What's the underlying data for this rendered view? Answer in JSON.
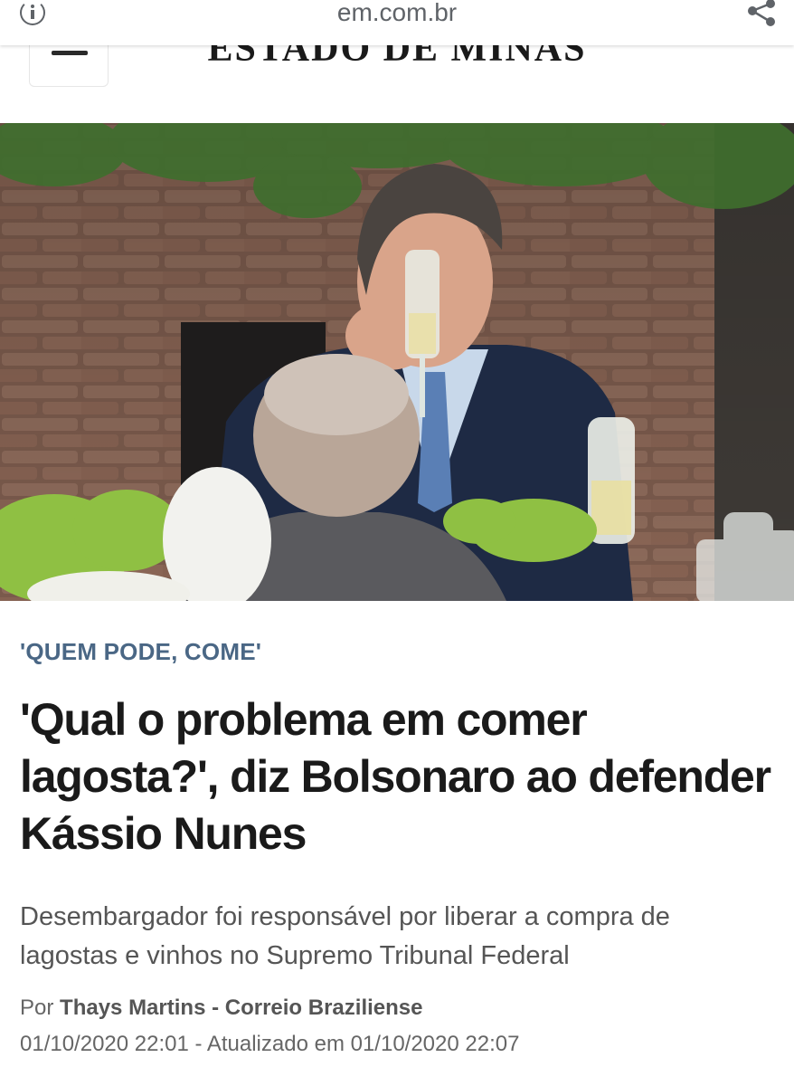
{
  "browser": {
    "url": "em.com.br",
    "info_icon": "info-icon",
    "share_icon": "share-icon"
  },
  "header": {
    "menu_icon": "hamburger-menu-icon",
    "masthead": "ESTADO DE MINAS"
  },
  "article": {
    "kicker": "'QUEM PODE, COME'",
    "headline": "'Qual o problema em comer lagosta?', diz Bolsonaro ao defender Kássio Nunes",
    "subhead": "Desembargador foi responsável por liberar a compra de lagostas e vinhos no Supremo Tribunal Federal",
    "byline_prefix": "Por",
    "author": "Thays Martins - Correio Braziliense",
    "published": "01/10/2020 22:01",
    "updated_label": "- Atualizado em",
    "updated": "01/10/2020 22:07"
  },
  "colors": {
    "kicker": "#4a6785",
    "headline": "#1a1a1a",
    "subhead": "#555555",
    "meta": "#666666"
  }
}
